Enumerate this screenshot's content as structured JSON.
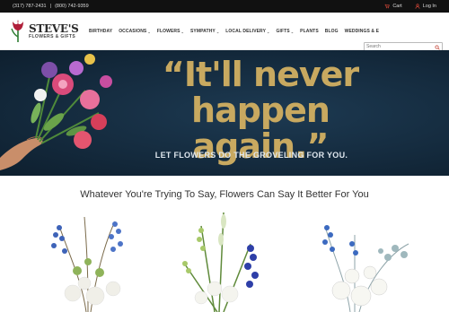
{
  "topbar": {
    "phone1": "(317) 787-2431",
    "sep": "|",
    "phone2": "(800) 742-9359",
    "cart_label": "Cart",
    "login_label": "Log In"
  },
  "logo": {
    "name": "STEVE'S",
    "sub": "FLOWERS & GIFTS"
  },
  "nav": {
    "items": [
      {
        "label": "BIRTHDAY",
        "dropdown": false
      },
      {
        "label": "OCCASIONS",
        "dropdown": true
      },
      {
        "label": "FLOWERS",
        "dropdown": true
      },
      {
        "label": "SYMPATHY",
        "dropdown": true
      },
      {
        "label": "LOCAL DELIVERY",
        "dropdown": true
      },
      {
        "label": "GIFTS",
        "dropdown": true
      },
      {
        "label": "PLANTS",
        "dropdown": false
      },
      {
        "label": "BLOG",
        "dropdown": false
      },
      {
        "label": "WEDDINGS & E",
        "dropdown": false
      }
    ]
  },
  "search": {
    "placeholder": "Search"
  },
  "hero": {
    "line1": "“It'll never",
    "line2": "happen again.”",
    "tagline": "LET FLOWERS DO THE GROVELING FOR YOU."
  },
  "section": {
    "title": "Whatever You're Trying To Say, Flowers Can Say It Better For You"
  },
  "colors": {
    "accent_red": "#c0392b",
    "hero_gold": "#c8a960",
    "hero_bg": "#142a3d"
  }
}
